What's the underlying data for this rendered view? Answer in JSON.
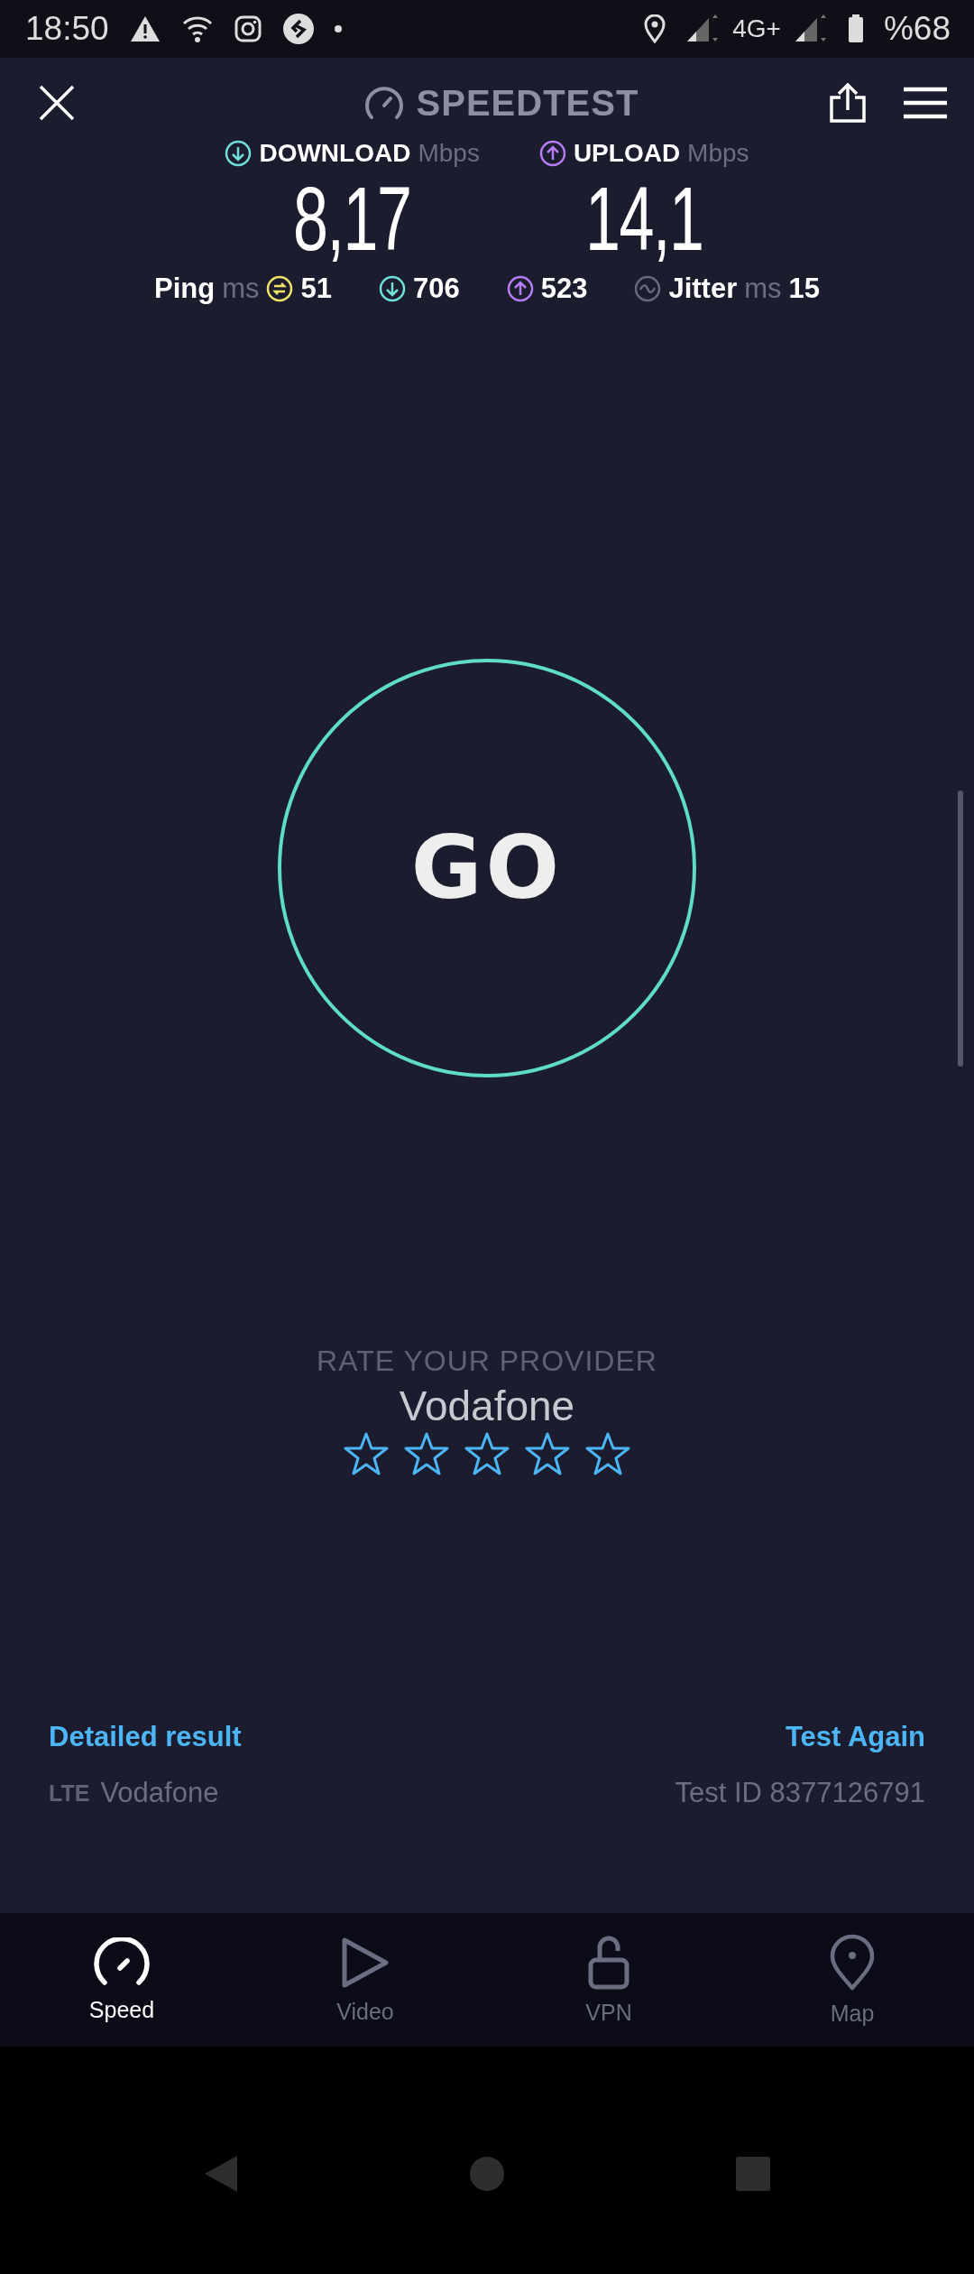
{
  "status_bar": {
    "time": "18:50",
    "network": "4G+",
    "battery": "%68"
  },
  "header": {
    "title": "SPEEDTEST"
  },
  "results": [
    {
      "kind": "download",
      "label": "DOWNLOAD",
      "unit": "Mbps",
      "value": "8,17",
      "color": "#6fe0d8"
    },
    {
      "kind": "upload",
      "label": "UPLOAD",
      "unit": "Mbps",
      "value": "14,1",
      "color": "#b77bf2"
    }
  ],
  "metrics": {
    "ping_label": "Ping",
    "ping_unit": "ms",
    "ping": "51",
    "download_latency": "706",
    "upload_latency": "523",
    "jitter_label": "Jitter",
    "jitter_unit": "ms",
    "jitter": "15"
  },
  "go_button": {
    "label": "GO"
  },
  "rating": {
    "prompt": "RATE YOUR PROVIDER",
    "provider": "Vodafone",
    "stars": 0
  },
  "footer": {
    "detailed_link": "Detailed result",
    "again_link": "Test Again",
    "connection_type": "LTE",
    "carrier": "Vodafone",
    "test_id": "Test ID 8377126791"
  },
  "tabs": [
    {
      "kind": "speed",
      "label": "Speed",
      "selected": true
    },
    {
      "kind": "video",
      "label": "Video",
      "selected": false
    },
    {
      "kind": "vpn",
      "label": "VPN",
      "selected": false
    },
    {
      "kind": "map",
      "label": "Map",
      "selected": false
    }
  ]
}
